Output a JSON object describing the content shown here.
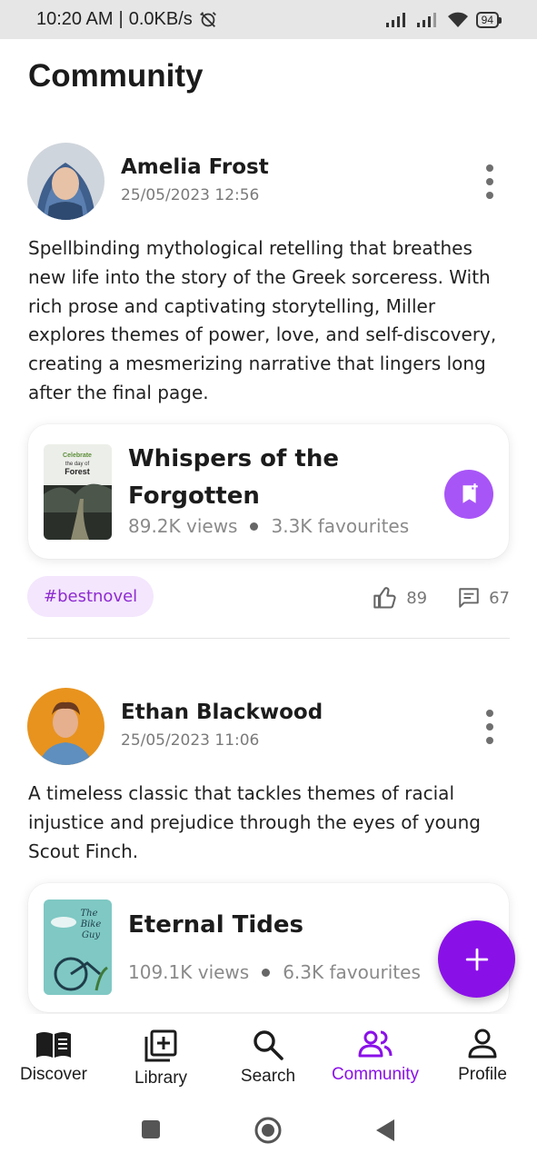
{
  "status_bar": {
    "time": "10:20 AM",
    "speed": "0.0KB/s",
    "battery": "94"
  },
  "page": {
    "title": "Community"
  },
  "posts": [
    {
      "author": "Amelia Frost",
      "datetime": "25/05/2023 12:56",
      "text": "Spellbinding mythological retelling that breathes new life into the story of the Greek sorceress. With rich prose and captivating storytelling, Miller explores themes of power, love, and self-discovery, creating a mesmerizing narrative that lingers long after the final page.",
      "book": {
        "title": "Whispers of the Forgotten",
        "views": "89.2K views",
        "favourites": "3.3K favourites",
        "cover_text": {
          "line1": "Celebrate",
          "line2": "the day of",
          "line3": "Forest"
        }
      },
      "tag": "#bestnovel",
      "likes": "89",
      "comments": "67"
    },
    {
      "author": "Ethan Blackwood",
      "datetime": "25/05/2023 11:06",
      "text": "A timeless classic that tackles themes of racial injustice and prejudice through the eyes of young Scout Finch.",
      "book": {
        "title": "Eternal Tides",
        "views": "109.1K views",
        "favourites": "6.3K favourites",
        "cover_text": {
          "line1": "The",
          "line2": "Bike",
          "line3": "Guy"
        }
      }
    }
  ],
  "fab": {
    "icon": "plus-icon"
  },
  "bottom_nav": [
    {
      "label": "Discover",
      "icon": "open-book-icon"
    },
    {
      "label": "Library",
      "icon": "library-add-icon"
    },
    {
      "label": "Search",
      "icon": "search-icon"
    },
    {
      "label": "Community",
      "icon": "people-icon",
      "active": true
    },
    {
      "label": "Profile",
      "icon": "person-icon"
    }
  ],
  "colors": {
    "accent": "#8a10e8",
    "bookmark": "#a855f7",
    "tag_bg": "#f3e6fd",
    "tag_text": "#8e2bd0"
  }
}
